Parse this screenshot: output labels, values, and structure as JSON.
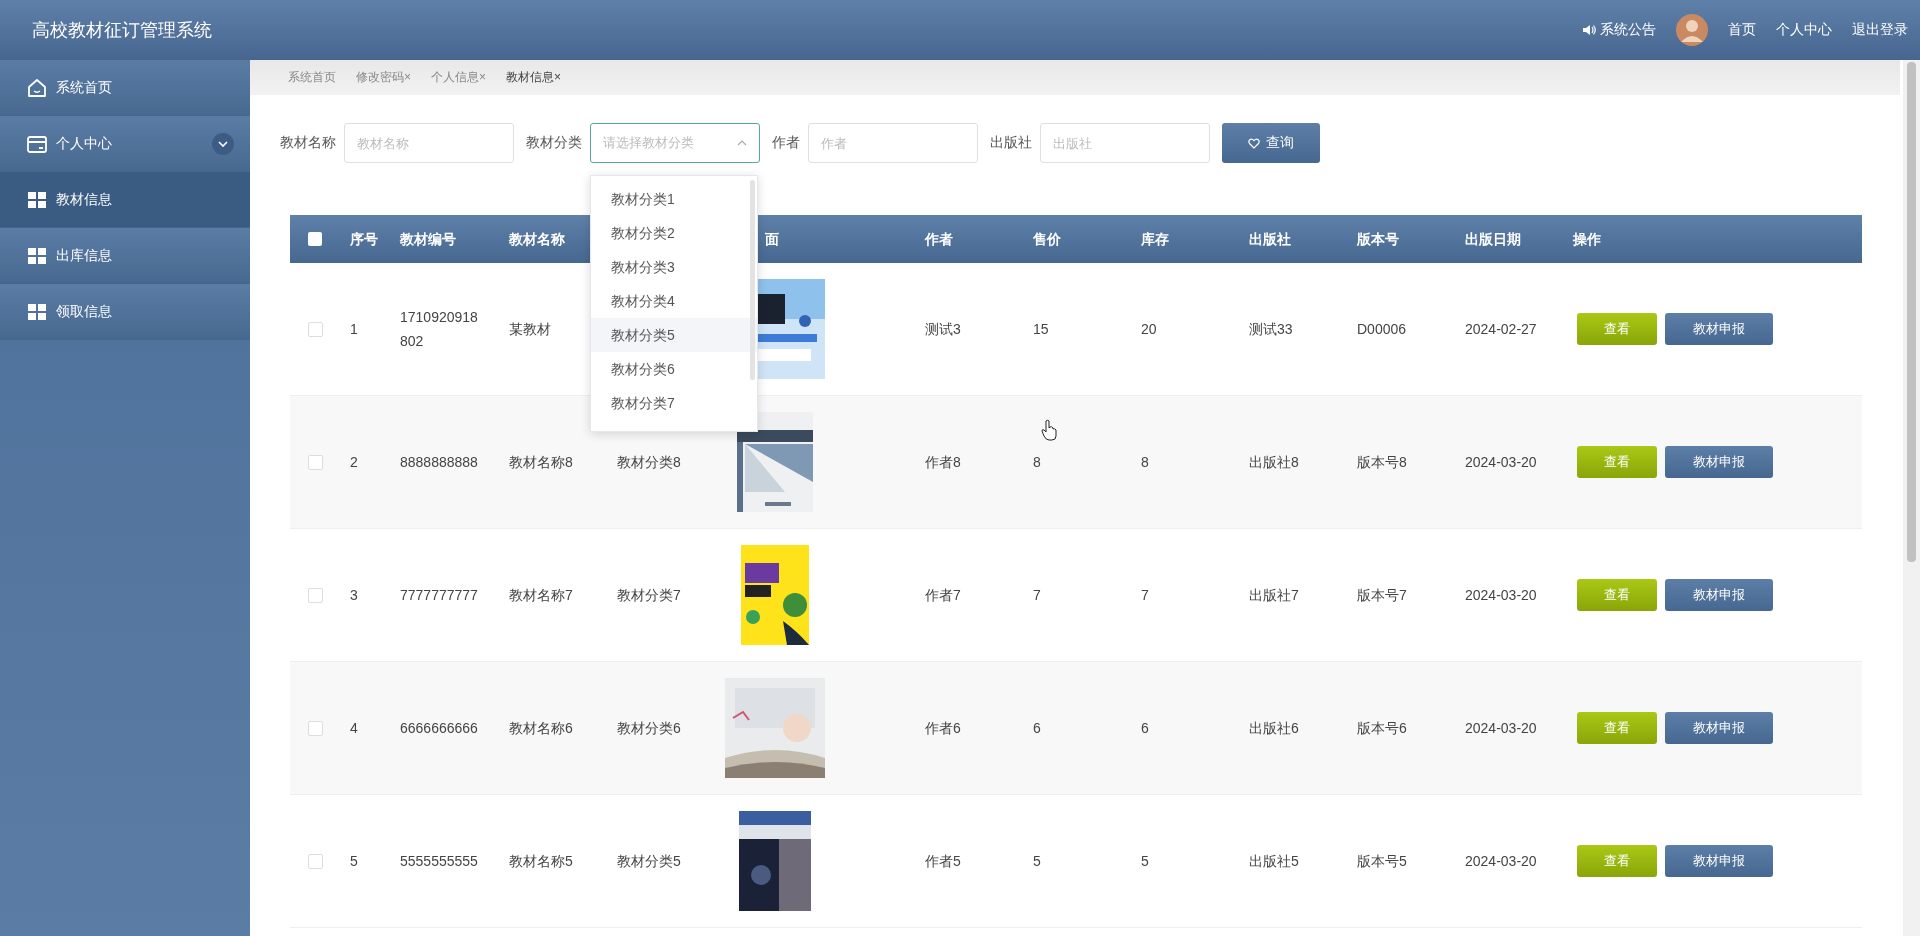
{
  "header": {
    "title": "高校教材征订管理系统",
    "notice": "系统公告",
    "links": [
      "首页",
      "个人中心",
      "退出登录"
    ]
  },
  "sidebar": {
    "items": [
      {
        "label": "系统首页",
        "kind": "home",
        "selected": false,
        "submenu": false
      },
      {
        "label": "个人中心",
        "kind": "card",
        "selected": false,
        "submenu": true
      },
      {
        "label": "教材信息",
        "kind": "grid",
        "selected": true,
        "submenu": false
      },
      {
        "label": "出库信息",
        "kind": "grid",
        "selected": false,
        "submenu": false
      },
      {
        "label": "领取信息",
        "kind": "grid",
        "selected": false,
        "submenu": false
      }
    ]
  },
  "tabs": [
    {
      "label": "系统首页",
      "selected": false
    },
    {
      "label": "修改密码×",
      "selected": false
    },
    {
      "label": "个人信息×",
      "selected": false
    },
    {
      "label": "教材信息×",
      "selected": true
    }
  ],
  "search": {
    "fields": [
      {
        "label": "教材名称",
        "placeholder": "教材名称",
        "kind": "input"
      },
      {
        "label": "教材分类",
        "placeholder": "请选择教材分类",
        "kind": "select",
        "open": true
      },
      {
        "label": "作者",
        "placeholder": "作者",
        "kind": "input"
      },
      {
        "label": "出版社",
        "placeholder": "出版社",
        "kind": "input"
      }
    ],
    "button": "查询",
    "dropdown": [
      {
        "label": "教材分类1",
        "hovered": false
      },
      {
        "label": "教材分类2",
        "hovered": false
      },
      {
        "label": "教材分类3",
        "hovered": false
      },
      {
        "label": "教材分类4",
        "hovered": false
      },
      {
        "label": "教材分类5",
        "hovered": true
      },
      {
        "label": "教材分类6",
        "hovered": false
      },
      {
        "label": "教材分类7",
        "hovered": false
      }
    ]
  },
  "table": {
    "select_all_checked": false,
    "columns": [
      {
        "label": "序号"
      },
      {
        "label": "教材编号"
      },
      {
        "label": "教材名称"
      },
      {
        "covered": true
      },
      {
        "label": "面"
      },
      {
        "label": "作者"
      },
      {
        "label": "售价"
      },
      {
        "label": "库存"
      },
      {
        "label": "出版社"
      },
      {
        "label": "版本号"
      },
      {
        "label": "出版日期"
      },
      {
        "label": "操作"
      }
    ],
    "rows": [
      {
        "checked": false,
        "cells": [
          "1",
          "1710920918802",
          "某教材",
          null,
          null,
          "测试3",
          "15",
          "20",
          "测试33",
          "D00006",
          "2024-02-27"
        ],
        "actions": [
          {
            "label": "查看",
            "kind": "view"
          },
          {
            "label": "教材申报",
            "kind": "apply"
          }
        ]
      },
      {
        "checked": false,
        "cells": [
          "2",
          "8888888888",
          "教材名称8",
          "教材分类8",
          null,
          "作者8",
          "8",
          "8",
          "出版社8",
          "版本号8",
          "2024-03-20"
        ],
        "actions": [
          {
            "label": "查看",
            "kind": "view"
          },
          {
            "label": "教材申报",
            "kind": "apply"
          }
        ]
      },
      {
        "checked": false,
        "cells": [
          "3",
          "7777777777",
          "教材名称7",
          "教材分类7",
          null,
          "作者7",
          "7",
          "7",
          "出版社7",
          "版本号7",
          "2024-03-20"
        ],
        "actions": [
          {
            "label": "查看",
            "kind": "view"
          },
          {
            "label": "教材申报",
            "kind": "apply"
          }
        ]
      },
      {
        "checked": false,
        "cells": [
          "4",
          "6666666666",
          "教材名称6",
          "教材分类6",
          null,
          "作者6",
          "6",
          "6",
          "出版社6",
          "版本号6",
          "2024-03-20"
        ],
        "actions": [
          {
            "label": "查看",
            "kind": "view"
          },
          {
            "label": "教材申报",
            "kind": "apply"
          }
        ]
      },
      {
        "checked": false,
        "cells": [
          "5",
          "5555555555",
          "教材名称5",
          "教材分类5",
          null,
          "作者5",
          "5",
          "5",
          "出版社5",
          "版本号5",
          "2024-03-20"
        ],
        "actions": [
          {
            "label": "查看",
            "kind": "view"
          },
          {
            "label": "教材申报",
            "kind": "apply"
          }
        ]
      }
    ]
  }
}
